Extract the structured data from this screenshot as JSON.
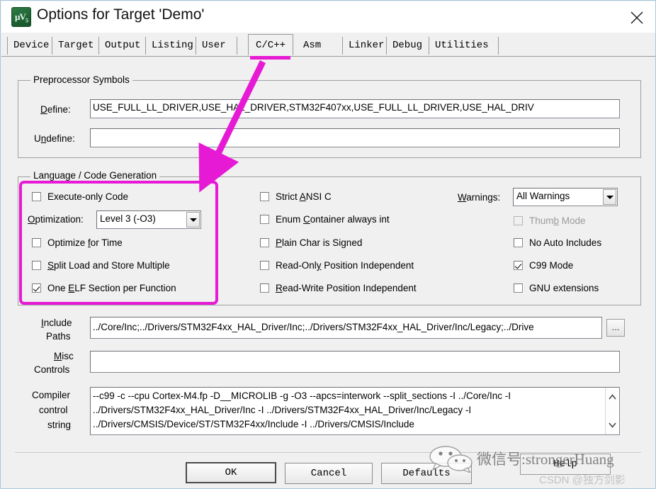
{
  "window": {
    "title": "Options for Target 'Demo'",
    "icon": "keil-uvision-icon",
    "close_label": "✕"
  },
  "tabs": [
    {
      "label": "Device",
      "active": false
    },
    {
      "label": "Target",
      "active": false
    },
    {
      "label": "Output",
      "active": false
    },
    {
      "label": "Listing",
      "active": false
    },
    {
      "label": "User",
      "active": false
    },
    {
      "label": "C/C++",
      "active": true
    },
    {
      "label": "Asm",
      "active": false
    },
    {
      "label": "Linker",
      "active": false
    },
    {
      "label": "Debug",
      "active": false
    },
    {
      "label": "Utilities",
      "active": false
    }
  ],
  "preprocessor": {
    "group_title": "Preprocessor Symbols",
    "define_label": "Define:",
    "define_value": "USE_FULL_LL_DRIVER,USE_HAL_DRIVER,STM32F407xx,USE_FULL_LL_DRIVER,USE_HAL_DRIV",
    "undefine_label": "Undefine:",
    "undefine_value": ""
  },
  "language": {
    "group_title": "Language / Code Generation",
    "execute_only_label": "Execute-only Code",
    "execute_only_checked": false,
    "optimization_label": "Optimization:",
    "optimization_value": "Level 3 (-O3)",
    "optimize_for_time_label": "Optimize for Time",
    "optimize_for_time_checked": false,
    "split_load_store_label": "Split Load and Store Multiple",
    "split_load_store_checked": false,
    "one_elf_section_label": "One ELF Section per Function",
    "one_elf_section_checked": true,
    "strict_ansi_label": "Strict ANSI C",
    "strict_ansi_checked": false,
    "enum_container_label": "Enum Container always int",
    "enum_container_checked": false,
    "plain_char_label": "Plain Char is Signed",
    "plain_char_checked": false,
    "ro_position_label": "Read-Only Position Independent",
    "ro_position_checked": false,
    "rw_position_label": "Read-Write Position Independent",
    "rw_position_checked": false,
    "warnings_label": "Warnings:",
    "warnings_value": "All Warnings",
    "thumb_mode_label": "Thumb Mode",
    "thumb_mode_checked": false,
    "thumb_mode_disabled": true,
    "no_auto_includes_label": "No Auto Includes",
    "no_auto_includes_checked": false,
    "c99_mode_label": "C99 Mode",
    "c99_mode_checked": true,
    "gnu_extensions_label": "GNU extensions",
    "gnu_extensions_checked": false
  },
  "paths": {
    "include_label_line1": "Include",
    "include_label_line2": "Paths",
    "include_value": "../Core/Inc;../Drivers/STM32F4xx_HAL_Driver/Inc;../Drivers/STM32F4xx_HAL_Driver/Inc/Legacy;../Drive",
    "browse_label": "...",
    "misc_label_line1": "Misc",
    "misc_label_line2": "Controls",
    "misc_value": ""
  },
  "compiler": {
    "label_line1": "Compiler",
    "label_line2": "control",
    "label_line3": "string",
    "value": "--c99 -c --cpu Cortex-M4.fp -D__MICROLIB -g -O3 --apcs=interwork --split_sections -I ../Core/Inc -I\n../Drivers/STM32F4xx_HAL_Driver/Inc -I ../Drivers/STM32F4xx_HAL_Driver/Inc/Legacy -I\n../Drivers/CMSIS/Device/ST/STM32F4xx/Include -I ../Drivers/CMSIS/Include"
  },
  "buttons": {
    "ok": "OK",
    "cancel": "Cancel",
    "defaults": "Defaults",
    "help": "Help"
  },
  "watermark": {
    "wechat_text": "微信号:strongerHuang",
    "csdn_text": "CSDN @独方剑影"
  },
  "annotation": {
    "highlight_color": "#e61ad4",
    "arrow_color": "#e61ad4"
  }
}
